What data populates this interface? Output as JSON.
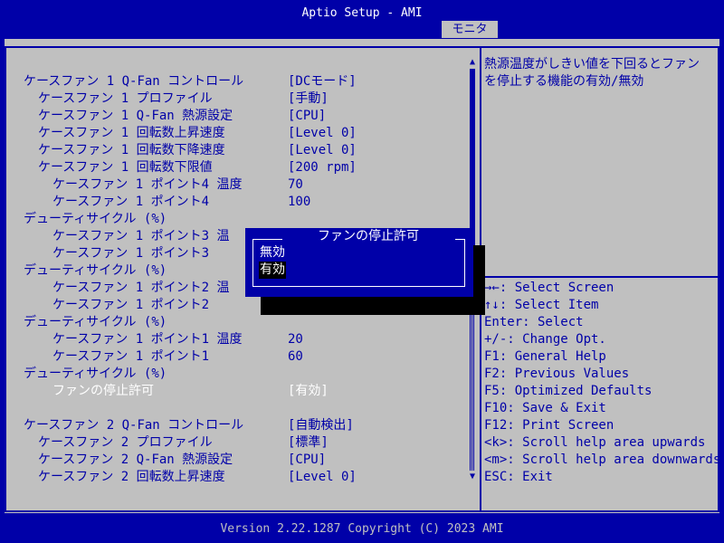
{
  "header": {
    "title": "Aptio Setup - AMI",
    "active_tab": "モニタ"
  },
  "settings": [
    {
      "label": "ケースファン 1 Q-Fan コントロール",
      "value": "[DCモード]"
    },
    {
      "label": "ケースファン 1 プロファイル",
      "value": "[手動]"
    },
    {
      "label": "ケースファン 1 Q-Fan 熱源設定",
      "value": "[CPU]"
    },
    {
      "label": "ケースファン 1 回転数上昇速度",
      "value": "[Level 0]"
    },
    {
      "label": "ケースファン 1 回転数下降速度",
      "value": "[Level 0]"
    },
    {
      "label": "ケースファン 1 回転数下限値",
      "value": "[200 rpm]"
    },
    {
      "label": "ケースファン 1 ポイント4 温度",
      "value": "70"
    },
    {
      "label": "ケースファン 1 ポイント4",
      "value": "100"
    },
    {
      "label": "デューティサイクル (%)",
      "value": ""
    },
    {
      "label": "ケースファン 1 ポイント3 温",
      "value": ""
    },
    {
      "label": "ケースファン 1 ポイント3",
      "value": ""
    },
    {
      "label": "デューティサイクル (%)",
      "value": ""
    },
    {
      "label": "ケースファン 1 ポイント2 温",
      "value": ""
    },
    {
      "label": "ケースファン 1 ポイント2",
      "value": ""
    },
    {
      "label": "デューティサイクル (%)",
      "value": ""
    },
    {
      "label": "ケースファン 1 ポイント1 温度",
      "value": "20"
    },
    {
      "label": "ケースファン 1 ポイント1",
      "value": "60"
    },
    {
      "label": "デューティサイクル (%)",
      "value": ""
    },
    {
      "label": "ファンの停止許可",
      "value": "[有効]"
    },
    {
      "label": "",
      "value": ""
    },
    {
      "label": "ケースファン 2 Q-Fan コントロール",
      "value": "[自動検出]"
    },
    {
      "label": "ケースファン 2 プロファイル",
      "value": "[標準]"
    },
    {
      "label": "ケースファン 2 Q-Fan 熱源設定",
      "value": "[CPU]"
    },
    {
      "label": "ケースファン 2 回転数上昇速度",
      "value": "[Level 0]"
    }
  ],
  "help": {
    "text": "熱源温度がしきい値を下回るとファンを停止する機能の有効/無効",
    "keys": [
      "→←: Select Screen",
      "↑↓: Select Item",
      "Enter: Select",
      "+/-: Change Opt.",
      "F1: General Help",
      "F2: Previous Values",
      "F5: Optimized Defaults",
      "F10: Save & Exit",
      "F12: Print Screen",
      "<k>: Scroll help area upwards",
      "<m>: Scroll help area downwards",
      "ESC: Exit"
    ]
  },
  "scrollbar": {
    "position_fraction": 0.0,
    "visible_fraction": 0.46
  },
  "popup": {
    "title": "ファンの停止許可",
    "options": [
      "無効",
      "有効"
    ],
    "selected_index": 1
  },
  "footer": {
    "text": "Version 2.22.1287 Copyright (C) 2023 AMI"
  }
}
